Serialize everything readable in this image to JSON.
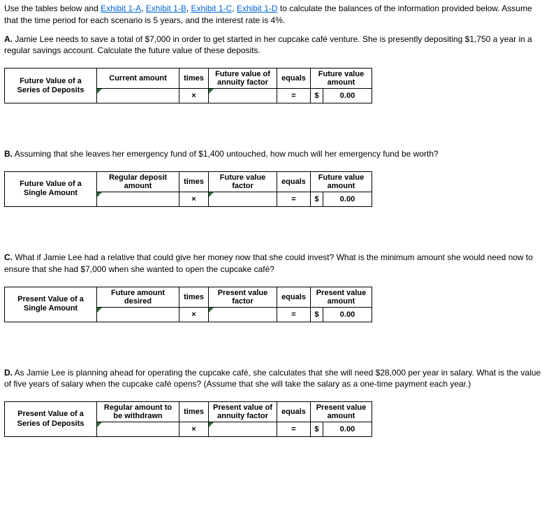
{
  "intro": {
    "part1": "Use the tables below and ",
    "ex1a": "Exhibit 1-A",
    "ex1b": "Exhibit 1-B",
    "ex1c": "Exhibit 1-C",
    "ex1d": "Exhibit 1-D",
    "part2": " to calculate the balances of the information provided below. Assume that the time period for each scenario is 5 years, and the interest rate is 4%."
  },
  "A": {
    "label": "A.",
    "text": " Jamie Lee needs to save a total of $7,000 in order to get started in her cupcake café venture. She is presently depositing $1,750 a year in a regular savings account. Calculate the future value of these deposits.",
    "row_label": "Future Value of a Series of Deposits",
    "h1": "Current amount",
    "h2": "times",
    "h3": "Future value of annuity factor",
    "h4": "equals",
    "h5": "Future value amount",
    "times": "×",
    "eq": "=",
    "dollar": "$",
    "result": "0.00"
  },
  "B": {
    "label": "B.",
    "text": " Assuming that she leaves her emergency fund of $1,400 untouched, how much will her emergency fund be worth?",
    "row_label": "Future Value of a Single Amount",
    "h1": "Regular deposit amount",
    "h2": "times",
    "h3": "Future value factor",
    "h4": "equals",
    "h5": "Future value amount",
    "times": "×",
    "eq": "=",
    "dollar": "$",
    "result": "0.00"
  },
  "C": {
    "label": "C.",
    "text": " What if Jamie Lee had a relative that could give her money now that she could invest? What is the minimum amount she would need now to ensure that she had $7,000 when she wanted to open the cupcake café?",
    "row_label": "Present Value of a Single Amount",
    "h1": "Future amount desired",
    "h2": "times",
    "h3": "Present value factor",
    "h4": "equals",
    "h5": "Present value amount",
    "times": "×",
    "eq": "=",
    "dollar": "$",
    "result": "0.00"
  },
  "D": {
    "label": "D.",
    "text": " As Jamie Lee is planning ahead for operating the cupcake café, she calculates that she will need $28,000 per year in salary. What is the value of five years of salary when the cupcake café opens? (Assume that she will take the salary as a one-time payment each year.)",
    "row_label": "Present Value of a Series of Deposits",
    "h1": "Regular amount to be withdrawn",
    "h2": "times",
    "h3": "Present value of annuity factor",
    "h4": "equals",
    "h5": "Present value amount",
    "times": "×",
    "eq": "=",
    "dollar": "$",
    "result": "0.00"
  }
}
